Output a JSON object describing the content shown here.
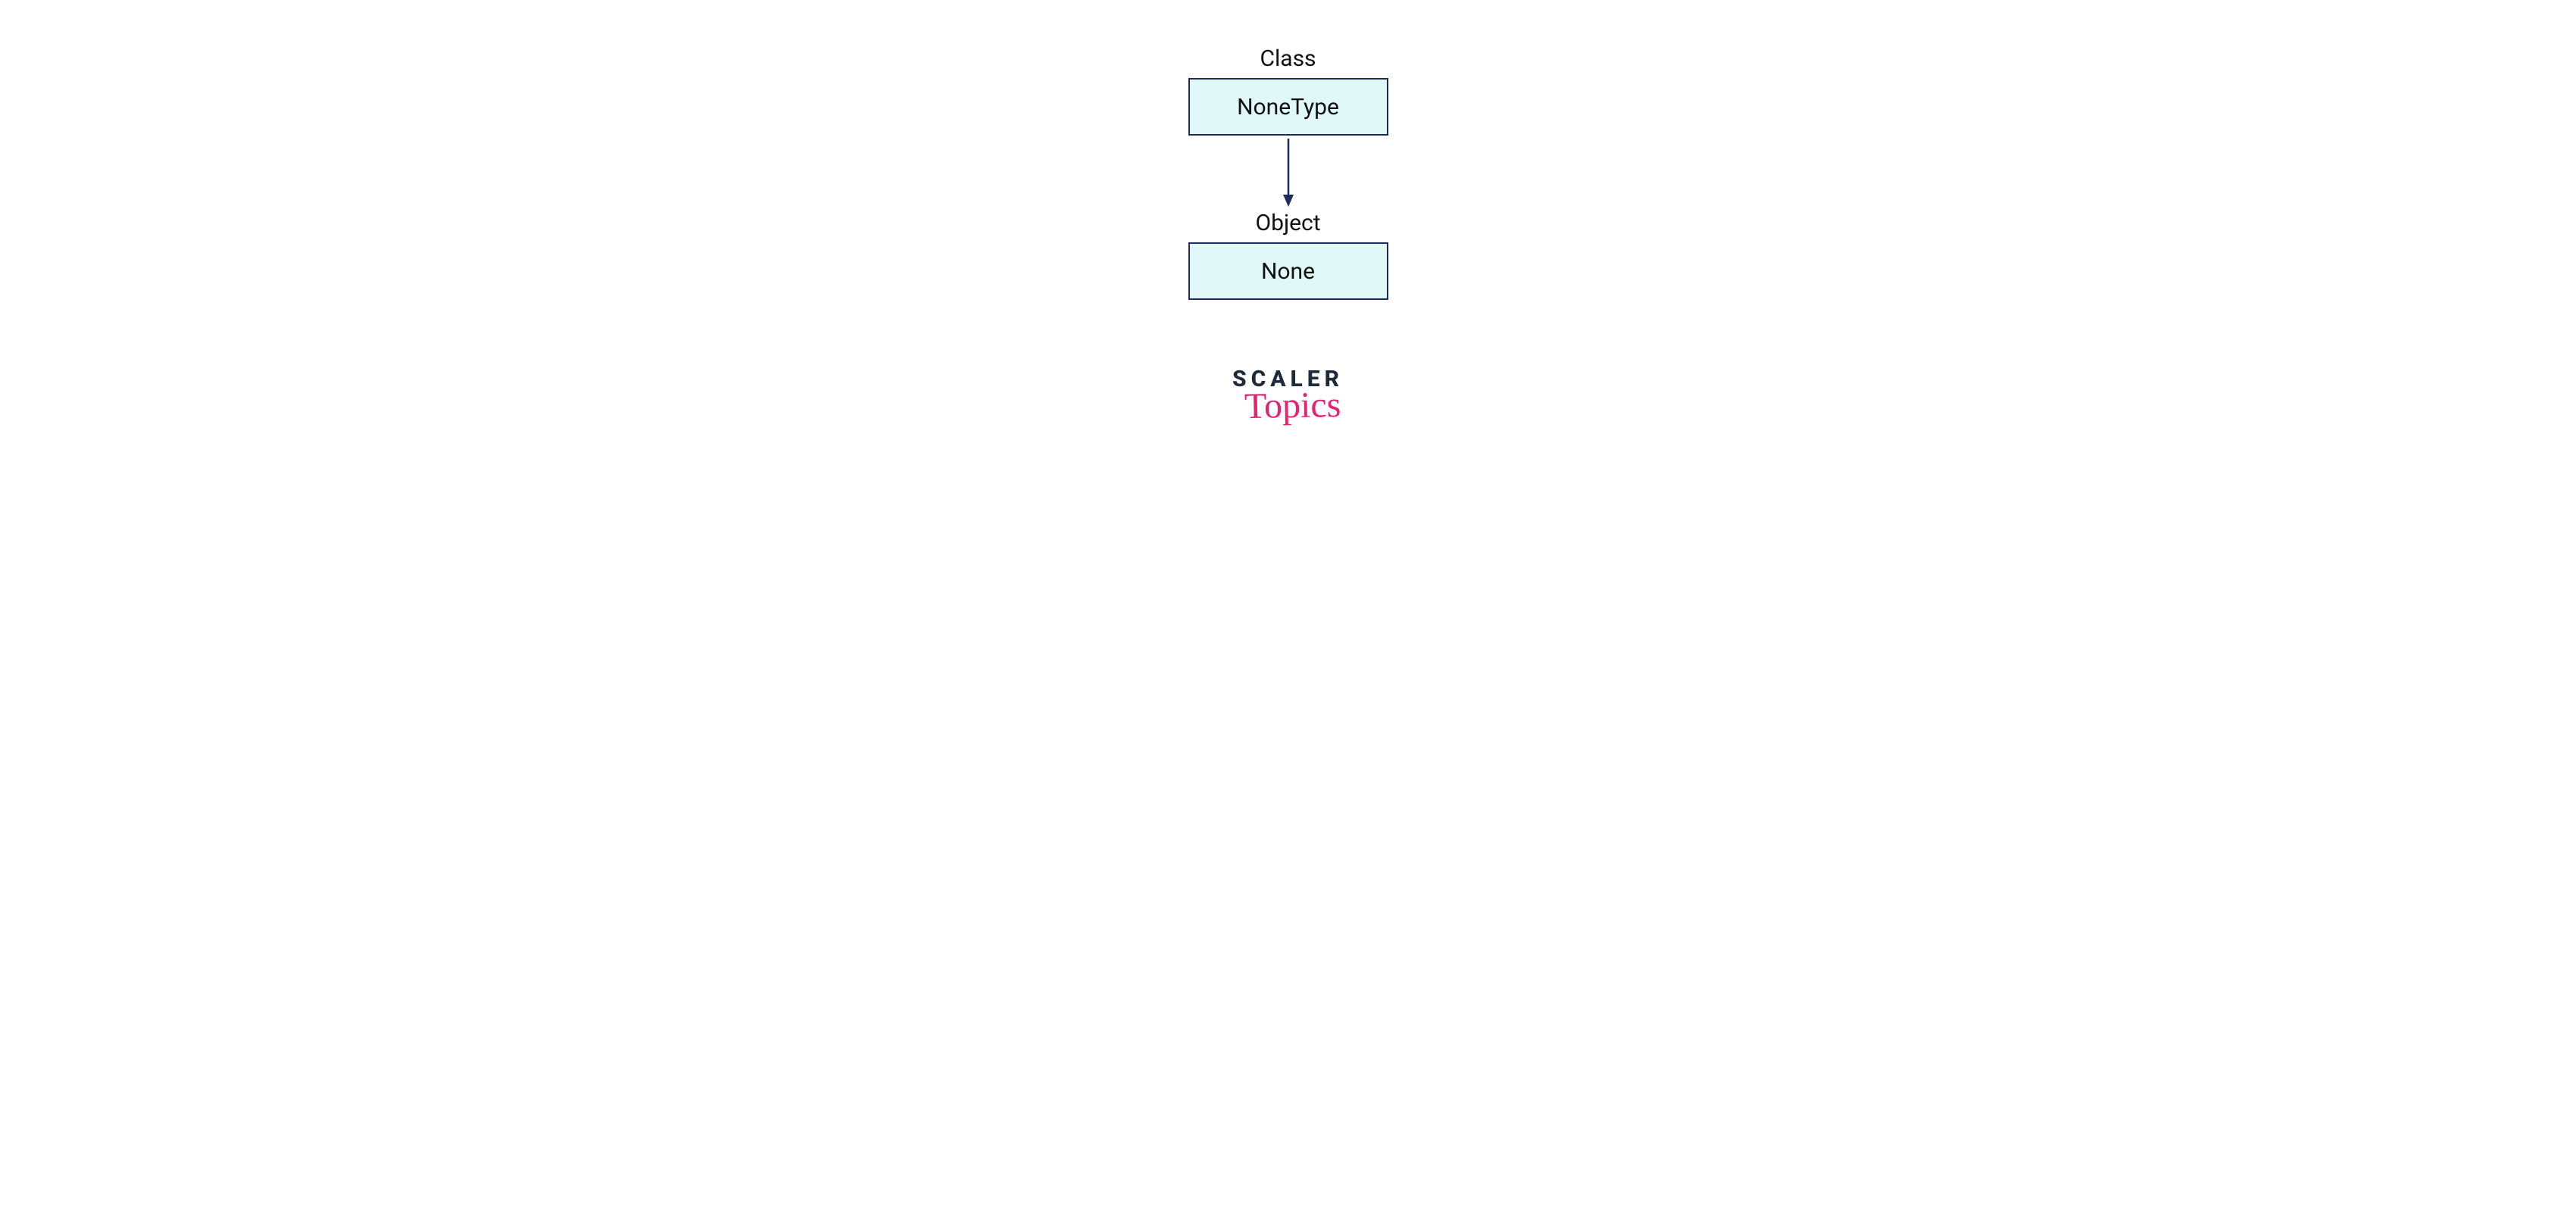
{
  "diagram": {
    "top_label": "Class",
    "top_box": "NoneType",
    "bottom_label": "Object",
    "bottom_box": "None"
  },
  "logo": {
    "line1": "SCALER",
    "line2": "Topics"
  },
  "palette": {
    "box_border": "#1f2a5c",
    "box_fill": "#e0f8f8",
    "logo_dark": "#1f2b3a",
    "logo_pink": "#e6216f"
  }
}
